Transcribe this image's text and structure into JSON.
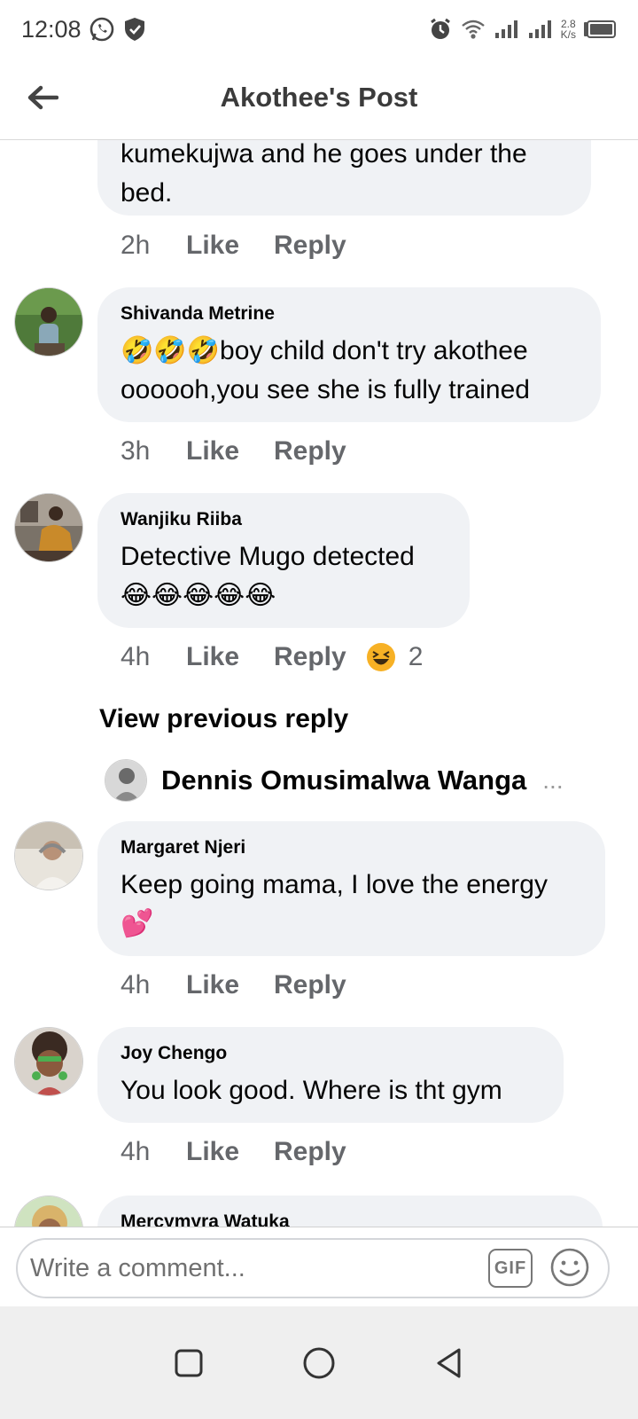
{
  "status": {
    "time": "12:08",
    "speed_value": "2.8",
    "speed_unit": "K/s"
  },
  "header": {
    "title": "Akothee's Post"
  },
  "comments": [
    {
      "text": "kumekujwa and he goes under the bed.",
      "time": "2h",
      "like": "Like",
      "reply": "Reply"
    },
    {
      "author": "Shivanda Metrine",
      "text": "🤣🤣🤣boy child don't try akothee oooooh,you see she is fully trained",
      "time": "3h",
      "like": "Like",
      "reply": "Reply"
    },
    {
      "author": "Wanjiku Riiba",
      "text": "Detective Mugo detected 😂😂😂😂😂",
      "time": "4h",
      "like": "Like",
      "reply": "Reply",
      "reaction_count": "2"
    },
    {
      "author": "Margaret Njeri",
      "text": "Keep going mama, I love the energy 💕",
      "time": "4h",
      "like": "Like",
      "reply": "Reply"
    },
    {
      "author": "Joy Chengo",
      "text": "You look good. Where is tht gym",
      "time": "4h",
      "like": "Like",
      "reply": "Reply"
    },
    {
      "author": "Mercymyra Watuka"
    }
  ],
  "thread": {
    "view_previous": "View previous reply",
    "reply_author": "Dennis Omusimalwa Wanga",
    "ellipsis": "..."
  },
  "composer": {
    "placeholder": "Write a comment...",
    "gif": "GIF"
  },
  "icons": {
    "back": "arrow-left-icon",
    "whatsapp": "whatsapp-icon",
    "shield": "shield-icon",
    "alarm": "alarm-icon",
    "wifi": "wifi-icon",
    "signal": "signal-icon",
    "battery": "battery-icon",
    "emoji": "smiley-icon",
    "nav_recents": "square-icon",
    "nav_home": "circle-icon",
    "nav_back": "triangle-back-icon"
  },
  "colors": {
    "bubble": "#f0f2f5",
    "meta_text": "#65676b",
    "nav_bg": "#efefef"
  }
}
